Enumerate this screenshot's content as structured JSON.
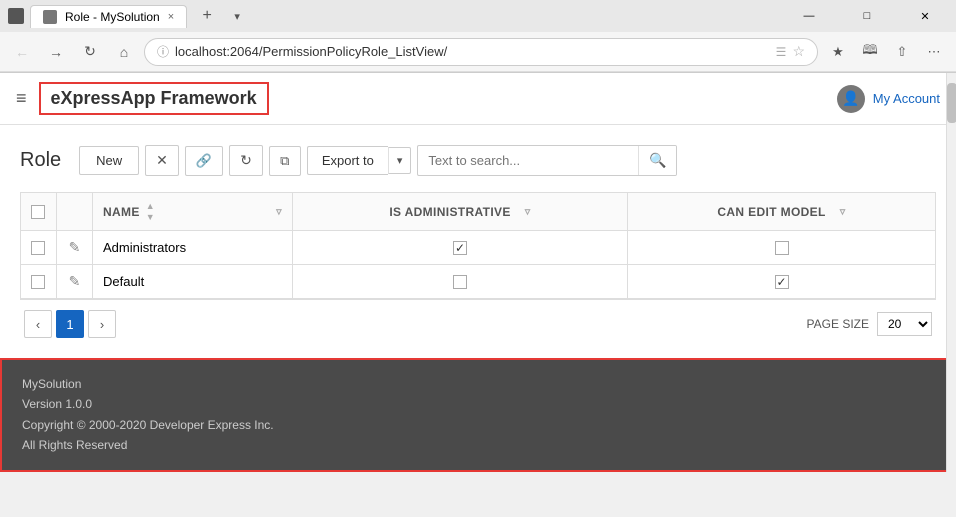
{
  "browser": {
    "tab_title": "Role - MySolution",
    "tab_close": "×",
    "address": "localhost:2064/PermissionPolicyRole_ListView/",
    "new_tab": "+",
    "win_minimize": "—",
    "win_maximize": "□",
    "win_close": "✕"
  },
  "header": {
    "hamburger": "≡",
    "app_title": "eXpressApp Framework",
    "account_label": "My Account"
  },
  "toolbar": {
    "page_title": "Role",
    "new_label": "New",
    "delete_icon": "✕",
    "link_icon": "🔗",
    "refresh_icon": "↻",
    "copy_icon": "⧉",
    "export_label": "Export to",
    "export_arrow": "▾",
    "search_placeholder": "Text to search...",
    "search_icon": "🔍"
  },
  "table": {
    "columns": [
      {
        "id": "check",
        "label": ""
      },
      {
        "id": "edit",
        "label": ""
      },
      {
        "id": "name",
        "label": "NAME"
      },
      {
        "id": "is_admin",
        "label": "IS ADMINISTRATIVE"
      },
      {
        "id": "can_edit",
        "label": "CAN EDIT MODEL"
      }
    ],
    "rows": [
      {
        "name": "Administrators",
        "is_admin": true,
        "can_edit": false
      },
      {
        "name": "Default",
        "is_admin": false,
        "can_edit": true
      }
    ]
  },
  "pagination": {
    "prev": "‹",
    "next": "›",
    "current_page": "1",
    "page_size_label": "PAGE SIZE",
    "page_size_value": "20"
  },
  "footer": {
    "line1": "MySolution",
    "line2": "Version 1.0.0",
    "line3": "Copyright © 2000-2020 Developer Express Inc.",
    "line4": "All Rights Reserved"
  }
}
